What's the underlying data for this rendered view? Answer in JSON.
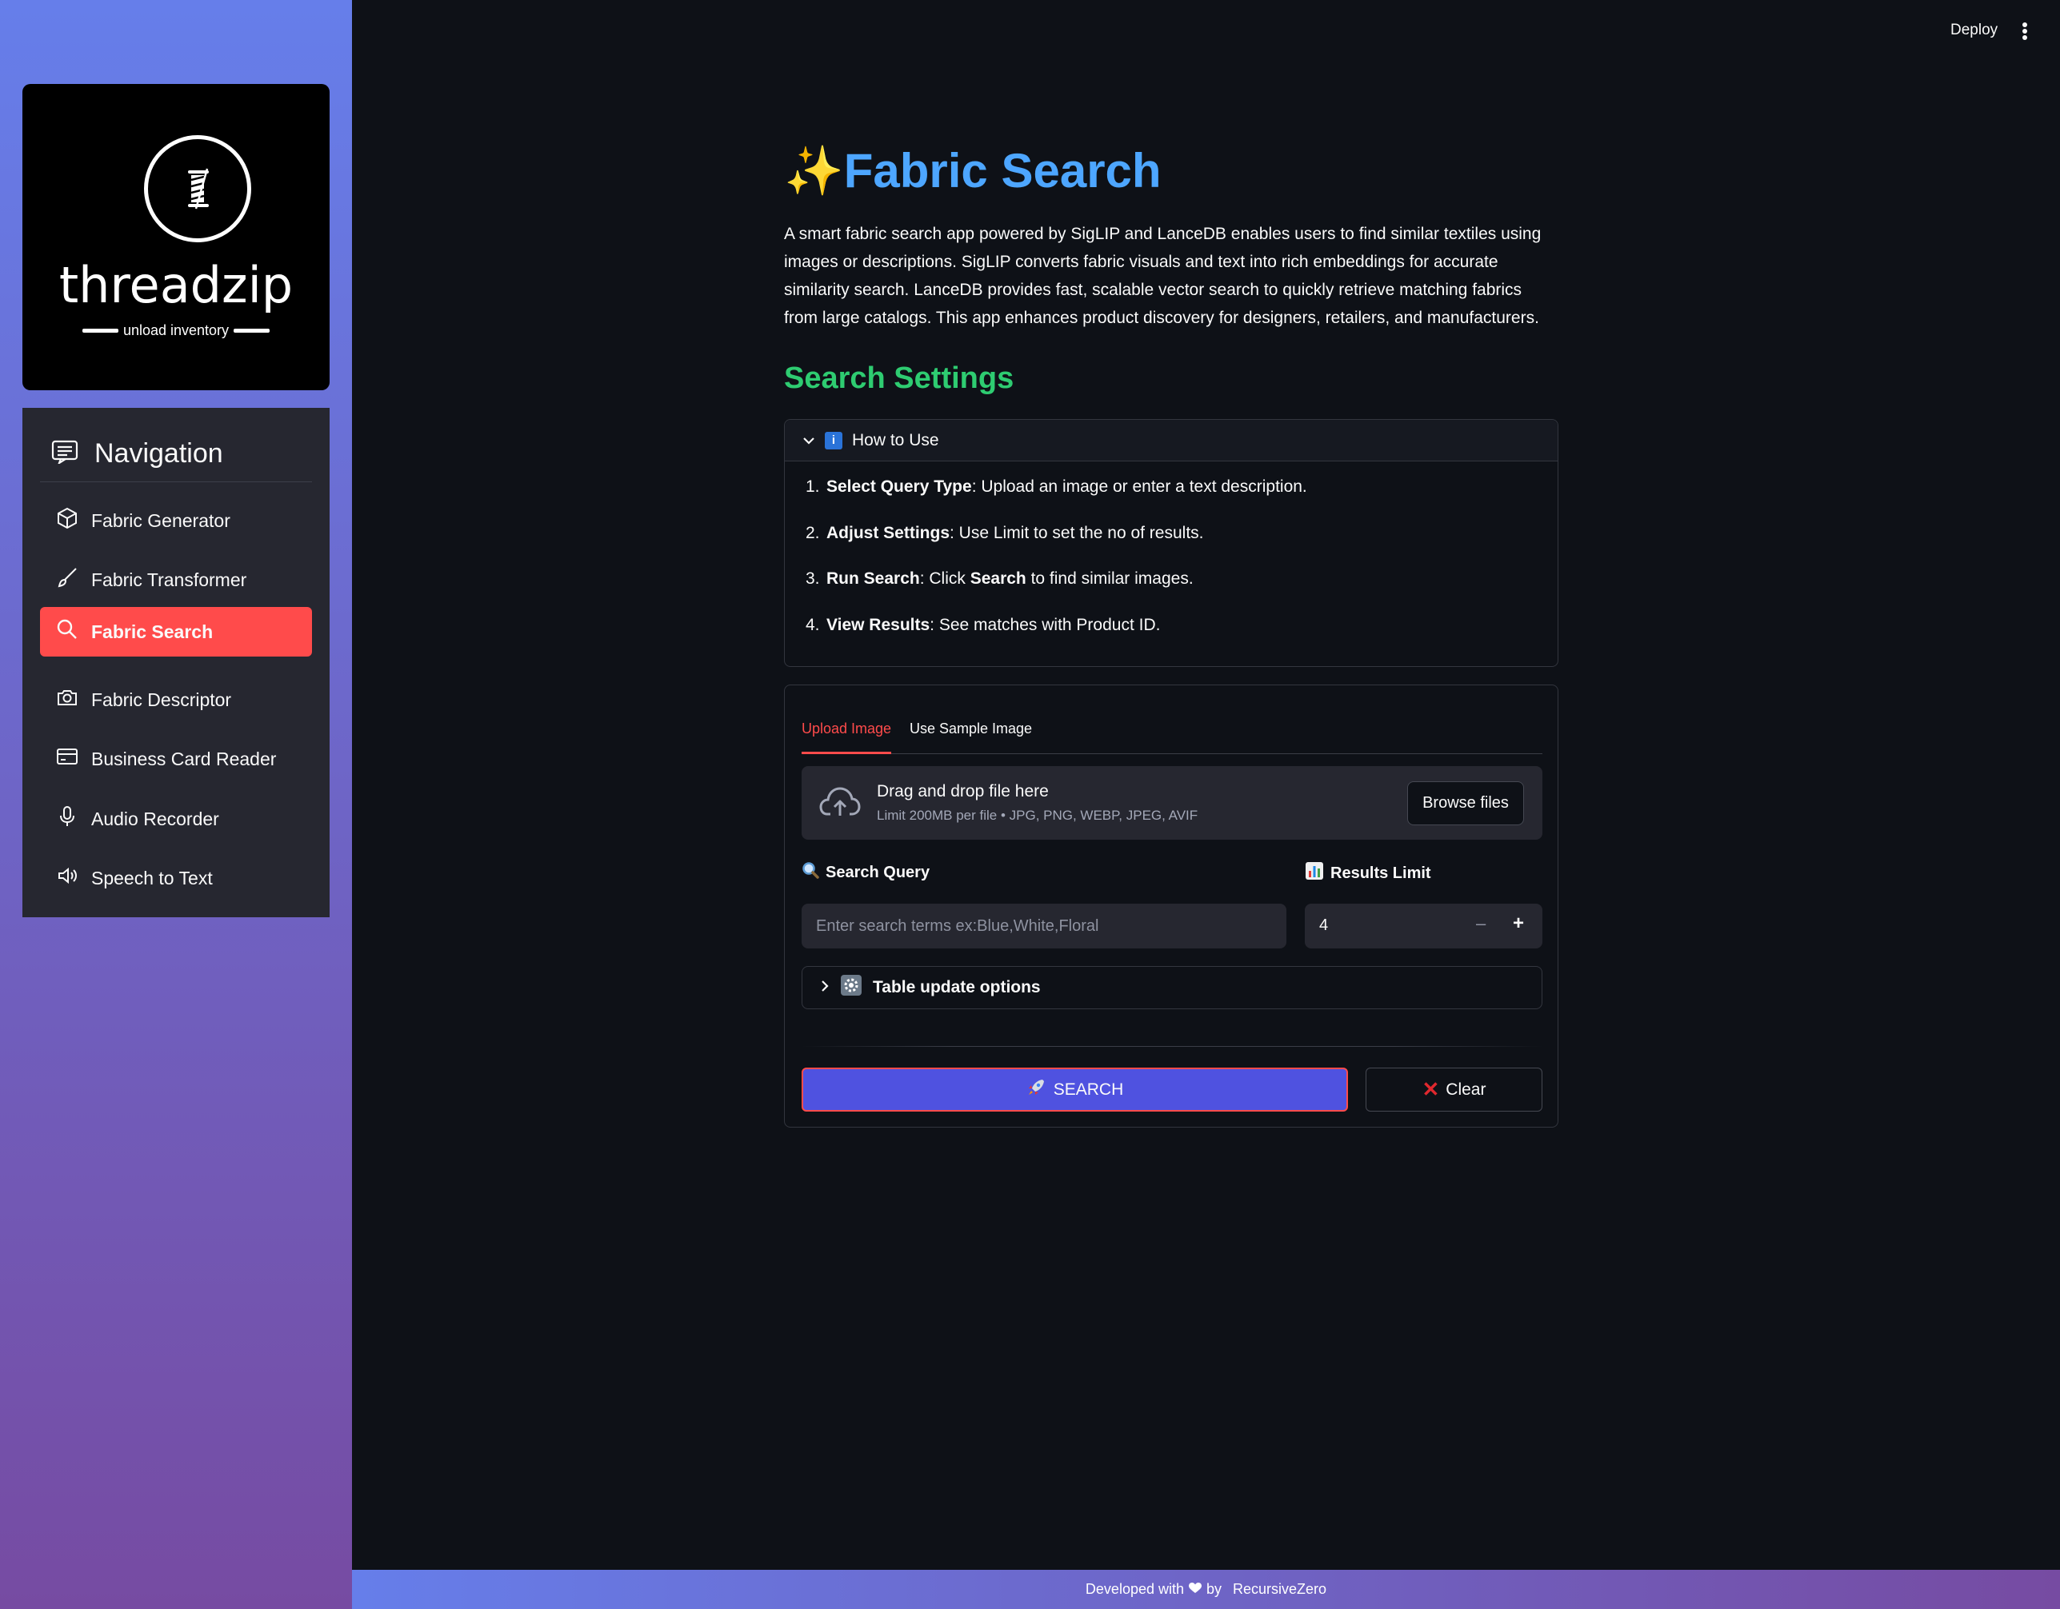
{
  "sidebar": {
    "logo": {
      "name": "threadzip",
      "tagline": "unload inventory"
    },
    "nav_title": "Navigation",
    "items": [
      {
        "label": "Fabric Generator",
        "icon": "cube-icon"
      },
      {
        "label": "Fabric Transformer",
        "icon": "brush-icon"
      },
      {
        "label": "Fabric Search",
        "icon": "search-icon",
        "active": true
      },
      {
        "label": "Fabric Descriptor",
        "icon": "camera-icon"
      },
      {
        "label": "Business Card Reader",
        "icon": "card-icon"
      },
      {
        "label": "Audio Recorder",
        "icon": "microphone-icon"
      },
      {
        "label": "Speech to Text",
        "icon": "speaker-icon"
      }
    ]
  },
  "topbar": {
    "deploy_label": "Deploy"
  },
  "main": {
    "title_emoji": "✨",
    "title": "Fabric Search",
    "intro": "A smart fabric search app powered by SigLIP and LanceDB enables users to find similar textiles using images or descriptions. SigLIP converts fabric visuals and text into rich embeddings for accurate similarity search. LanceDB provides fast, scalable vector search to quickly retrieve matching fabrics from large catalogs. This app enhances product discovery for designers, retailers, and manufacturers.",
    "settings_heading": "Search Settings",
    "howto": {
      "title": "How to Use",
      "steps": [
        {
          "num": "1.",
          "bold": "Select Query Type",
          "text": ": Upload an image or enter a text description."
        },
        {
          "num": "2.",
          "bold": "Adjust Settings",
          "text": ": Use Limit to set the no of results."
        },
        {
          "num": "3.",
          "bold": "Run Search",
          "text": ": Click ",
          "bold2": "Search",
          "text2": " to find similar images."
        },
        {
          "num": "4.",
          "bold": "View Results",
          "text": ": See matches with Product ID."
        }
      ]
    },
    "tabs": [
      {
        "label": "Upload Image",
        "active": true
      },
      {
        "label": "Use Sample Image",
        "active": false
      }
    ],
    "dropzone": {
      "title": "Drag and drop file here",
      "subtitle": "Limit 200MB per file • JPG, PNG, WEBP, JPEG, AVIF",
      "browse_label": "Browse files"
    },
    "query": {
      "label": "Search Query",
      "placeholder": "Enter search terms ex:Blue,White,Floral",
      "value": ""
    },
    "limit": {
      "label": "Results Limit",
      "value": "4",
      "minus": "–",
      "plus": "+"
    },
    "table_options_label": "Table update options",
    "search_button": "SEARCH",
    "clear_button": "Clear"
  },
  "footer": {
    "prefix": "Developed with",
    "by": "by",
    "author": "RecursiveZero"
  },
  "colors": {
    "accent": "#ff4b4b",
    "title": "#4da6ff",
    "heading": "#2ecc71",
    "search_button": "#4f52e0",
    "background": "#0e1117"
  }
}
